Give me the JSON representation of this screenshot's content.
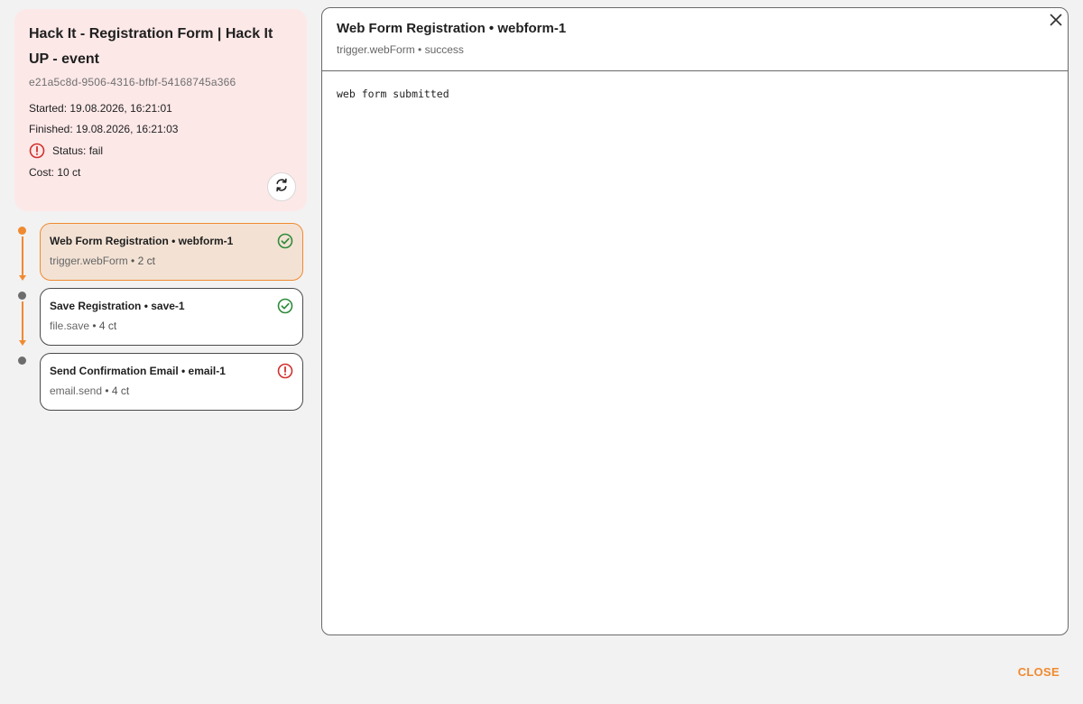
{
  "run": {
    "title": "Hack It - Registration Form | Hack It UP - event",
    "id": "e21a5c8d-9506-4316-bfbf-54168745a366",
    "started": "Started: 19.08.2026, 16:21:01",
    "finished": "Finished: 19.08.2026, 16:21:03",
    "status": "Status: fail",
    "cost": "Cost: 10 ct",
    "status_icon": "alert-circle-icon",
    "rerun_icon": "refresh-icon"
  },
  "steps": [
    {
      "title": "Web Form Registration • webform-1",
      "type": "trigger.webForm",
      "cost": " • 2 ct",
      "state": "success",
      "icon": "check-circle-icon"
    },
    {
      "title": "Save Registration • save-1",
      "type": "file.save",
      "cost": " • 4 ct",
      "state": "success",
      "icon": "check-circle-icon"
    },
    {
      "title": "Send Confirmation Email • email-1",
      "type": "email.send",
      "cost": " • 4 ct",
      "state": "fail",
      "icon": "alert-circle-icon"
    }
  ],
  "detail": {
    "title": "Web Form Registration • webform-1",
    "subtitle": "trigger.webForm • success",
    "output": "web form submitted",
    "close_icon": "close-icon"
  },
  "footer": {
    "close_label": "CLOSE"
  },
  "colors": {
    "accent": "#f08a30",
    "success": "#2e8b3a",
    "fail": "#d0312d",
    "fail_bg": "#fde8e8"
  }
}
